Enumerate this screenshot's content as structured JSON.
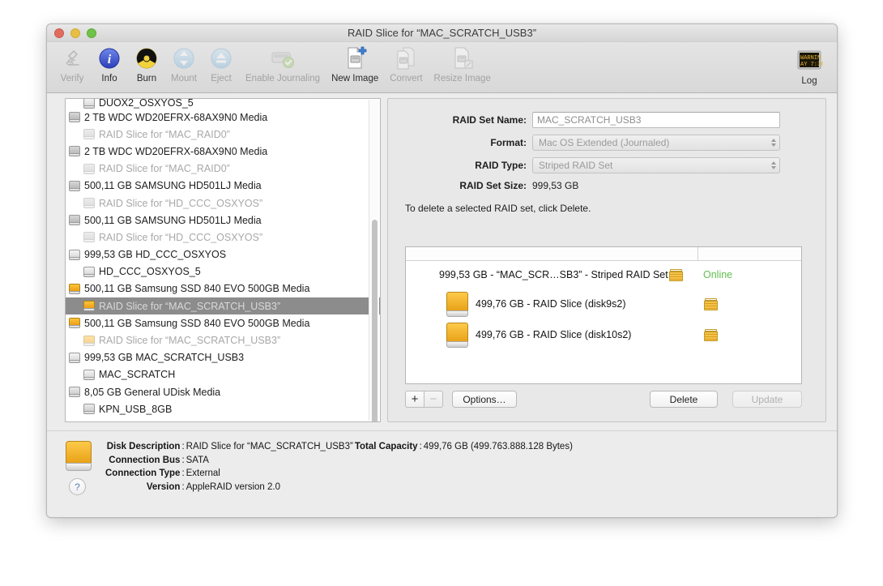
{
  "window": {
    "title": "RAID Slice for “MAC_SCRATCH_USB3”",
    "traffic_lights": [
      "close",
      "minimize",
      "zoom"
    ]
  },
  "toolbar": {
    "items": [
      {
        "label": "Verify",
        "icon": "microscope-icon",
        "enabled": false
      },
      {
        "label": "Info",
        "icon": "info-icon",
        "enabled": true
      },
      {
        "label": "Burn",
        "icon": "burn-icon",
        "enabled": true
      },
      {
        "label": "Mount",
        "icon": "mount-icon",
        "enabled": false
      },
      {
        "label": "Eject",
        "icon": "eject-icon",
        "enabled": false
      },
      {
        "label": "Enable Journaling",
        "icon": "journaling-icon",
        "enabled": false
      },
      {
        "label": "New Image",
        "icon": "new-image-icon",
        "enabled": true
      },
      {
        "label": "Convert",
        "icon": "convert-icon",
        "enabled": false
      },
      {
        "label": "Resize Image",
        "icon": "resize-image-icon",
        "enabled": false
      }
    ],
    "log": {
      "label": "Log",
      "icon": "log-icon",
      "screen_text_line1": "WARNIN",
      "screen_text_line2": "AY 7:36"
    }
  },
  "device_list": {
    "items": [
      {
        "label": "DUOX2_OSXYOS_5",
        "type": "volume",
        "indent": true,
        "muted": false,
        "selected": false,
        "clipped": true
      },
      {
        "label": "2 TB WDC WD20EFRX-68AX9N0 Media",
        "type": "disk",
        "indent": false,
        "muted": false,
        "selected": false
      },
      {
        "label": "RAID Slice for “MAC_RAID0”",
        "type": "disk",
        "indent": true,
        "muted": true,
        "selected": false
      },
      {
        "label": "2 TB WDC WD20EFRX-68AX9N0 Media",
        "type": "disk",
        "indent": false,
        "muted": false,
        "selected": false
      },
      {
        "label": "RAID Slice for “MAC_RAID0”",
        "type": "disk",
        "indent": true,
        "muted": true,
        "selected": false
      },
      {
        "label": "500,11 GB SAMSUNG HD501LJ Media",
        "type": "disk",
        "indent": false,
        "muted": false,
        "selected": false
      },
      {
        "label": "RAID Slice for “HD_CCC_OSXYOS”",
        "type": "disk",
        "indent": true,
        "muted": true,
        "selected": false
      },
      {
        "label": "500,11 GB SAMSUNG HD501LJ Media",
        "type": "disk",
        "indent": false,
        "muted": false,
        "selected": false
      },
      {
        "label": "RAID Slice for “HD_CCC_OSXYOS”",
        "type": "disk",
        "indent": true,
        "muted": true,
        "selected": false
      },
      {
        "label": "999,53 GB HD_CCC_OSXYOS",
        "type": "volume",
        "indent": false,
        "muted": false,
        "selected": false
      },
      {
        "label": "HD_CCC_OSXYOS_5",
        "type": "volume",
        "indent": true,
        "muted": false,
        "selected": false
      },
      {
        "label": "500,11 GB Samsung SSD 840 EVO 500GB Media",
        "type": "orange",
        "indent": false,
        "muted": false,
        "selected": false
      },
      {
        "label": "RAID Slice for “MAC_SCRATCH_USB3”",
        "type": "orange",
        "indent": true,
        "muted": false,
        "selected": true
      },
      {
        "label": "500,11 GB Samsung SSD 840 EVO 500GB Media",
        "type": "orange",
        "indent": false,
        "muted": false,
        "selected": false
      },
      {
        "label": "RAID Slice for “MAC_SCRATCH_USB3”",
        "type": "orange",
        "indent": true,
        "muted": true,
        "selected": false
      },
      {
        "label": "999,53 GB MAC_SCRATCH_USB3",
        "type": "volume",
        "indent": false,
        "muted": false,
        "selected": false
      },
      {
        "label": "MAC_SCRATCH",
        "type": "volume",
        "indent": true,
        "muted": false,
        "selected": false
      },
      {
        "label": "8,05 GB General UDisk Media",
        "type": "usb",
        "indent": false,
        "muted": false,
        "selected": false
      },
      {
        "label": "KPN_USB_8GB",
        "type": "usb",
        "indent": true,
        "muted": false,
        "selected": false
      }
    ]
  },
  "raid_panel": {
    "fields": [
      {
        "label": "RAID Set Name:",
        "value": "MAC_SCRATCH_USB3",
        "control": "textfield"
      },
      {
        "label": "Format:",
        "value": "Mac OS Extended (Journaled)",
        "control": "popup"
      },
      {
        "label": "RAID Type:",
        "value": "Striped RAID Set",
        "control": "popup"
      },
      {
        "label": "RAID Set Size:",
        "value": "999,53 GB",
        "control": "static"
      }
    ],
    "hint": "To delete a selected RAID set, click Delete.",
    "set_table": {
      "set_row": {
        "label": "999,53 GB - “MAC_SCR…SB3” - Striped RAID Set",
        "status": "Online",
        "status_color": "#5fbf4e"
      },
      "slices": [
        {
          "label": "499,76 GB - RAID Slice (disk9s2)"
        },
        {
          "label": "499,76 GB - RAID Slice (disk10s2)"
        }
      ]
    },
    "buttons": {
      "add": "+",
      "remove": "−",
      "options": "Options…",
      "delete": "Delete",
      "update": "Update"
    }
  },
  "info_panel": {
    "rows": [
      {
        "key": "Disk Description",
        "value": "RAID Slice for “MAC_SCRATCH_USB3”",
        "key2": "Total Capacity",
        "value2": "499,76 GB (499.763.888.128 Bytes)"
      },
      {
        "key": "Connection Bus",
        "value": "SATA"
      },
      {
        "key": "Connection Type",
        "value": "External"
      },
      {
        "key": "Version",
        "value": "AppleRAID version 2.0"
      }
    ],
    "help_label": "?"
  }
}
